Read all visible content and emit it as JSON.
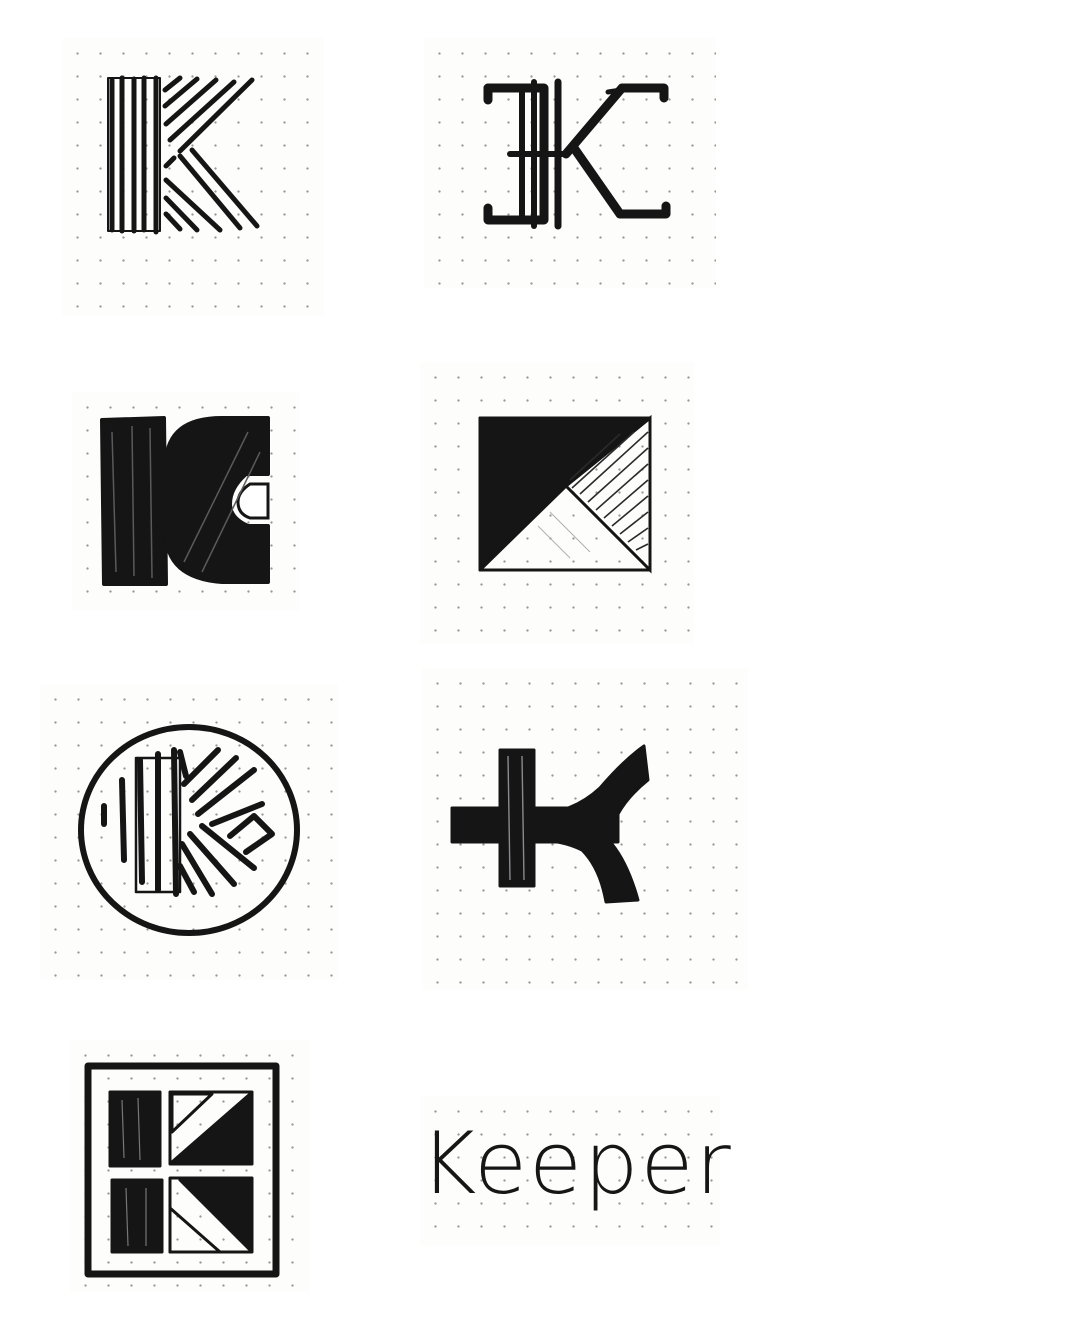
{
  "sheet": {
    "sketches": [
      {
        "id": "k-striped-lines",
        "icon": "striped-k-icon"
      },
      {
        "id": "k-serif-outline",
        "icon": "serif-k-icon"
      },
      {
        "id": "k-solid-block",
        "icon": "block-k-icon"
      },
      {
        "id": "k-triangle-square",
        "icon": "triangle-k-icon"
      },
      {
        "id": "k-circle-badge",
        "icon": "circle-k-icon"
      },
      {
        "id": "k-cross-curve",
        "icon": "curve-k-icon"
      },
      {
        "id": "k-framed-grid",
        "icon": "framed-k-icon"
      },
      {
        "id": "keeper-wordmark",
        "icon": "wordmark-icon"
      }
    ],
    "wordmark": "Keeper"
  }
}
